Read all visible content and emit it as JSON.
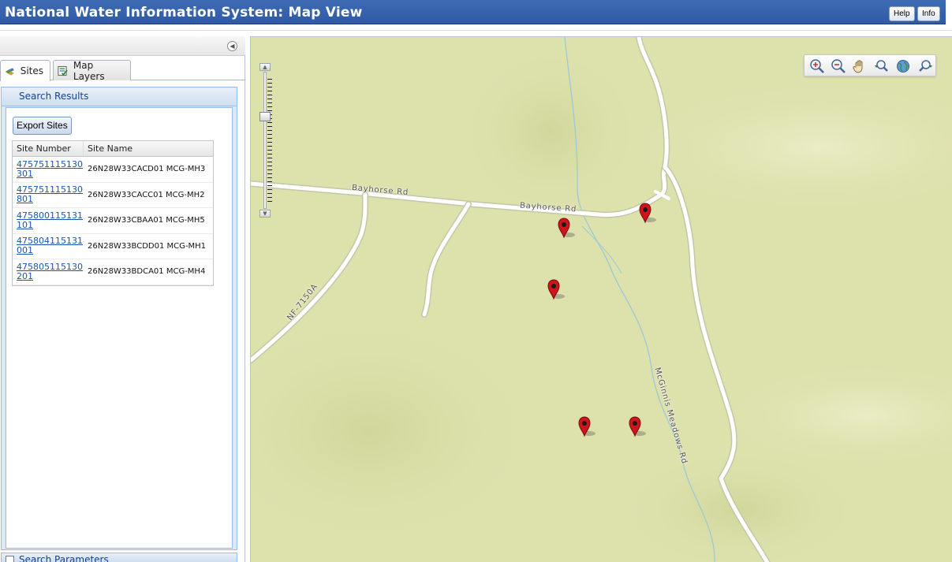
{
  "header": {
    "title": "National Water Information System: Map View",
    "help_label": "Help",
    "info_label": "Info"
  },
  "left_panel": {
    "tabs": [
      {
        "label": "Sites",
        "icon": "sites-icon",
        "active": true
      },
      {
        "label": "Map Layers",
        "icon": "layers-icon",
        "active": false
      }
    ],
    "results": {
      "title": "Search Results",
      "export_label": "Export Sites",
      "columns": [
        "Site Number",
        "Site Name"
      ],
      "rows": [
        {
          "number": "475751115130301",
          "name": "26N28W33CACD01 MCG-MH3"
        },
        {
          "number": "475751115130801",
          "name": "26N28W33CACC01 MCG-MH2"
        },
        {
          "number": "475800115131101",
          "name": "26N28W33CBAA01 MCG-MH5"
        },
        {
          "number": "475804115131001",
          "name": "26N28W33BCDD01 MCG-MH1"
        },
        {
          "number": "475805115130201",
          "name": "26N28W33BDCA01 MCG-MH4"
        }
      ]
    },
    "params_title": "Search Parameters"
  },
  "map": {
    "road_labels": {
      "bayhorse_1": "Bayhorse Rd",
      "bayhorse_2": "Bayhorse Rd",
      "nf": "NF-7150A",
      "mcginnis": "McGinnis Meadows Rd"
    },
    "tools": [
      "zoom-in-box-icon",
      "zoom-out-box-icon",
      "pan-hand-icon",
      "zoom-previous-icon",
      "full-extent-globe-icon",
      "zoom-next-icon"
    ],
    "colors": {
      "terrain": "#dde1ac",
      "road": "#ffffff",
      "stream": "#9ec9d6",
      "marker": "#d0141c"
    }
  }
}
